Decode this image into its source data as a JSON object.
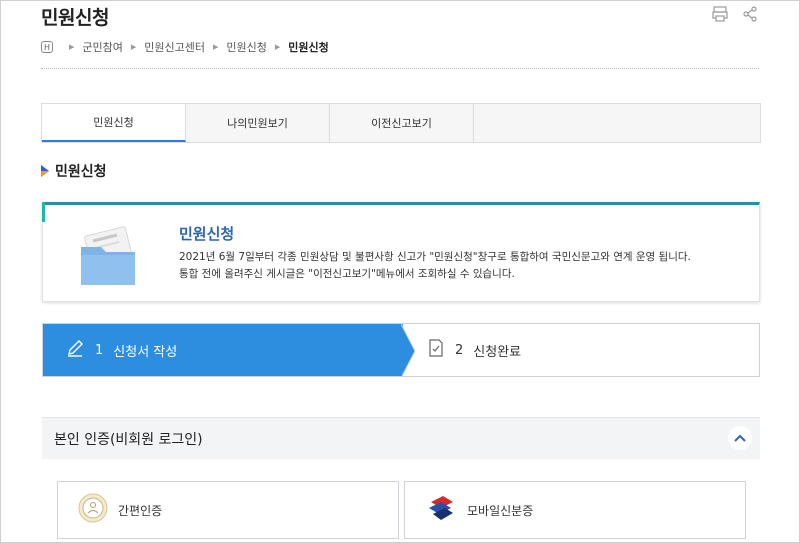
{
  "header": {
    "title": "민원신청",
    "tools": [
      {
        "name": "print-icon"
      },
      {
        "name": "share-icon"
      }
    ]
  },
  "breadcrumb": {
    "home_icon": "home-icon",
    "home_glyph": "H",
    "items": [
      "군민참여",
      "민원신고센터",
      "민원신청",
      "민원신청"
    ]
  },
  "tabs": [
    {
      "label": "민원신청",
      "active": true
    },
    {
      "label": "나의민원보기",
      "active": false
    },
    {
      "label": "이전신고보기",
      "active": false
    }
  ],
  "section": {
    "title": "민원신청"
  },
  "info_card": {
    "title": "민원신청",
    "lines": [
      "2021년 6월 7일부터 각종 민원상담 및 불편사항 신고가 \"민원신청\"창구로 통합하여 국민신문고와 연계 운영 됩니다.",
      "통합 전에 올려주신 게시글은 \"이전신고보기\"메뉴에서 조회하실 수 있습니다."
    ]
  },
  "steps": [
    {
      "number": "1",
      "label": "신청서 작성",
      "active": true,
      "icon": "pencil-icon"
    },
    {
      "number": "2",
      "label": "신청완료",
      "active": false,
      "icon": "document-icon"
    }
  ],
  "auth": {
    "label": "본인 인증(비회원 로그인)",
    "toggle_icon": "chevron-up-icon"
  },
  "options": [
    {
      "label": "간편인증",
      "icon": "simple-auth-icon"
    },
    {
      "label": "모바일신분증",
      "icon": "mobile-id-icon"
    }
  ],
  "colors": {
    "accent": "#2d8ee0",
    "card_title": "#2a66b8",
    "tab_underline": "#2a7fd4"
  }
}
